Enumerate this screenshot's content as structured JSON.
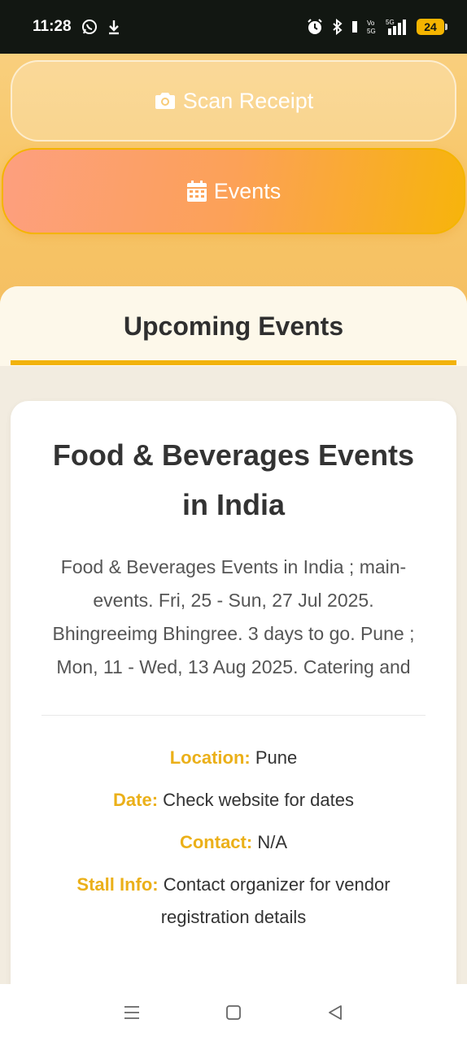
{
  "status_bar": {
    "time": "11:28",
    "battery": "24",
    "network": "5G",
    "volte": "Vo 5G"
  },
  "buttons": {
    "scan_receipt": "Scan Receipt",
    "events": "Events"
  },
  "panel": {
    "title": "Upcoming Events"
  },
  "event": {
    "title_line1": "Food & Beverages Events",
    "title_line2": "in India",
    "description": "Food & Beverages Events in India ; main-events. Fri, 25 - Sun, 27 Jul 2025. Bhingreeimg Bhingree. 3 days to go. Pune ; Mon, 11 - Wed, 13 Aug 2025. Catering and",
    "location_label": "Location:",
    "location_value": "Pune",
    "date_label": "Date:",
    "date_value": "Check website for dates",
    "contact_label": "Contact:",
    "contact_value": "N/A",
    "stall_label": "Stall Info:",
    "stall_value": "Contact organizer for vendor registration details"
  },
  "icons": {
    "scan": "camera-icon",
    "events": "calendar-icon",
    "nav_recents": "menu-lines-icon",
    "nav_home": "square-icon",
    "nav_back": "triangle-back-icon"
  },
  "colors": {
    "accent": "#f2b20c",
    "label": "#ebb019",
    "status_bar": "#121712"
  }
}
